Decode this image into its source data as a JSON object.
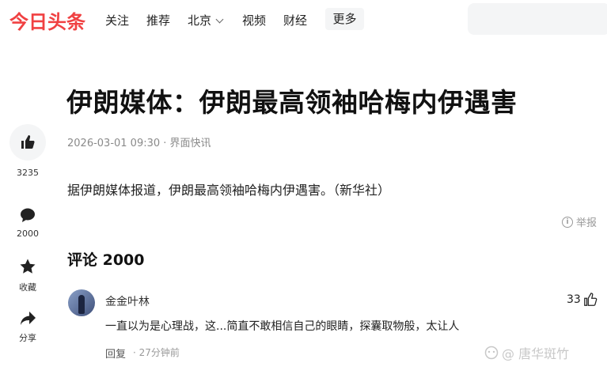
{
  "header": {
    "logo": "今日头条",
    "nav": [
      "关注",
      "推荐",
      "北京",
      "视频",
      "财经"
    ],
    "more_label": "更多"
  },
  "article": {
    "title": "伊朗媒体：伊朗最高领袖哈梅内伊遇害",
    "meta": "2026-03-01 09:30 · 界面快讯",
    "body": "据伊朗媒体报道，伊朗最高领袖哈梅内伊遇害。（新华社）",
    "report_label": "举报"
  },
  "sidebar": {
    "likes_count": "3235",
    "comments_count": "2000",
    "collect_label": "收藏",
    "share_label": "分享"
  },
  "comments": {
    "header": "评论 2000",
    "items": [
      {
        "user": "金金叶林",
        "likes": "33",
        "text": "一直以为是心理战，这...简直不敢相信自己的眼睛，探囊取物般，太让人",
        "reply_label": "回复",
        "time": "· 27分钟前"
      }
    ]
  },
  "watermark": "@ 唐华斑竹",
  "colors": {
    "brand": "#f04142",
    "secondary_text": "#8a8a8a"
  }
}
